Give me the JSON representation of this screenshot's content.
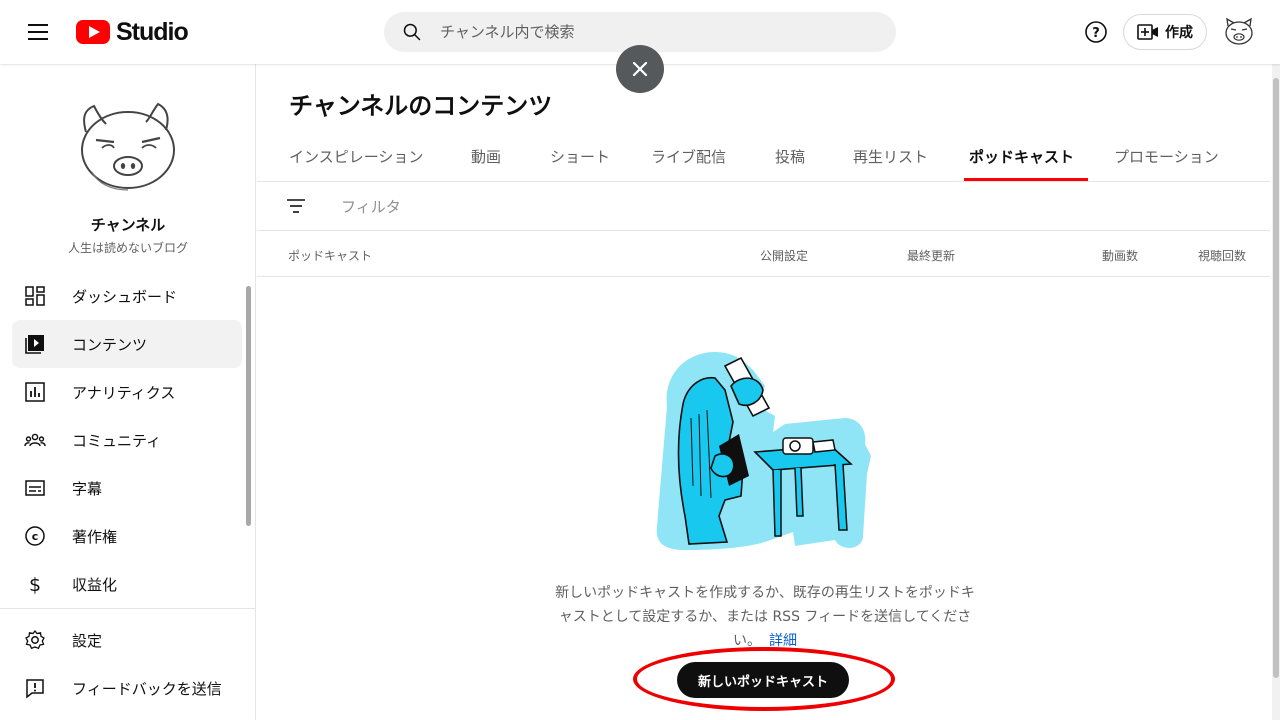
{
  "header": {
    "logo_text": "Studio",
    "search_placeholder": "チャンネル内で検索",
    "create_label": "作成",
    "colors": {
      "brand": "#ff0000",
      "search_bg": "#f0f0f0"
    }
  },
  "sidebar": {
    "channel_name": "チャンネル",
    "channel_subtitle": "人生は読めないブログ",
    "items": [
      {
        "label": "ダッシュボード",
        "icon": "dashboard-icon",
        "active": false
      },
      {
        "label": "コンテンツ",
        "icon": "content-icon",
        "active": true
      },
      {
        "label": "アナリティクス",
        "icon": "analytics-icon",
        "active": false
      },
      {
        "label": "コミュニティ",
        "icon": "community-icon",
        "active": false
      },
      {
        "label": "字幕",
        "icon": "subtitles-icon",
        "active": false
      },
      {
        "label": "著作権",
        "icon": "copyright-icon",
        "active": false
      },
      {
        "label": "収益化",
        "icon": "dollar-icon",
        "active": false
      }
    ],
    "footer_items": [
      {
        "label": "設定",
        "icon": "gear-icon"
      },
      {
        "label": "フィードバックを送信",
        "icon": "feedback-icon"
      }
    ]
  },
  "main": {
    "title": "チャンネルのコンテンツ",
    "tabs": [
      {
        "label": "インスピレーション",
        "active": false
      },
      {
        "label": "動画",
        "active": false
      },
      {
        "label": "ショート",
        "active": false
      },
      {
        "label": "ライブ配信",
        "active": false
      },
      {
        "label": "投稿",
        "active": false
      },
      {
        "label": "再生リスト",
        "active": false
      },
      {
        "label": "ポッドキャスト",
        "active": true
      },
      {
        "label": "プロモーション",
        "active": false
      }
    ],
    "filter_placeholder": "フィルタ",
    "columns": [
      "ポッドキャスト",
      "公開設定",
      "最終更新",
      "動画数",
      "視聴回数"
    ],
    "empty_message_line1": "新しいポッドキャストを作成するか、既存の再生リストをポッドキ",
    "empty_message_line2": "ャストとして設定するか、または RSS フィードを送信してくださ",
    "empty_message_line3": "い。",
    "learn_more": "詳細",
    "new_podcast_button": "新しいポッドキャスト",
    "colors": {
      "accent_underline": "#ff0000",
      "link": "#065fd4",
      "annotation_ring": "#ee0000"
    }
  }
}
